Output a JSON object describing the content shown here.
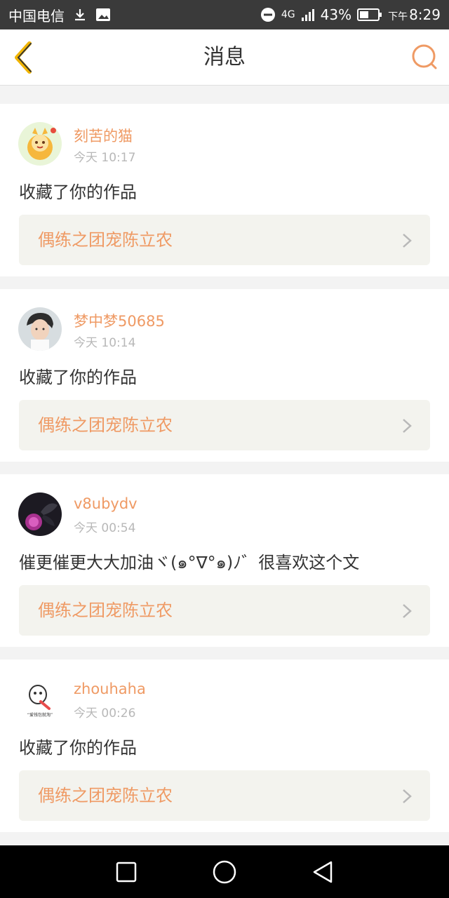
{
  "status_bar": {
    "carrier": "中国电信",
    "network": "4G",
    "battery": "43%",
    "time_prefix": "下午",
    "time": "8:29",
    "icons": [
      "download-icon",
      "image-icon",
      "dnd-icon",
      "signal-icon",
      "battery-icon"
    ]
  },
  "header": {
    "title": "消息",
    "accent_color": "#ef9a64"
  },
  "messages": [
    {
      "username": "刻苦的猫",
      "time": "今天 10:17",
      "text": "收藏了你的作品",
      "work": "偶练之团宠陈立农",
      "avatar": "cartoon-cat-avatar"
    },
    {
      "username": "梦中梦50685",
      "time": "今天 10:14",
      "text": "收藏了你的作品",
      "work": "偶练之团宠陈立农",
      "avatar": "person-avatar"
    },
    {
      "username": "v8ubydv",
      "time": "今天 00:54",
      "text": "催更催更大大加油ヾ(๑°∇°๑)ﾉ゛很喜欢这个文",
      "work": "偶练之团宠陈立农",
      "avatar": "butterfly-avatar"
    },
    {
      "username": "zhouhaha",
      "time": "今天 00:26",
      "text": "收藏了你的作品",
      "work": "偶练之团宠陈立农",
      "avatar": "sticker-avatar"
    }
  ],
  "avatar_caption": "“爱钱包就淘”"
}
